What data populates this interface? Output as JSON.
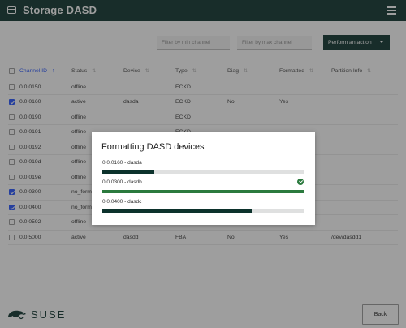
{
  "header": {
    "title": "Storage DASD"
  },
  "filters": {
    "min_placeholder": "Filter by min channel",
    "max_placeholder": "Filter by max channel",
    "action_label": "Perform an action"
  },
  "table": {
    "columns": {
      "channel_id": "Channel ID",
      "status": "Status",
      "device": "Device",
      "type": "Type",
      "diag": "Diag",
      "formatted": "Formatted",
      "partition_info": "Partition Info"
    },
    "rows": [
      {
        "checked": false,
        "channel_id": "0.0.0150",
        "status": "offline",
        "device": "",
        "type": "ECKD",
        "diag": "",
        "formatted": "",
        "partition_info": ""
      },
      {
        "checked": true,
        "channel_id": "0.0.0160",
        "status": "active",
        "device": "dasda",
        "type": "ECKD",
        "diag": "No",
        "formatted": "Yes",
        "partition_info": ""
      },
      {
        "checked": false,
        "channel_id": "0.0.0190",
        "status": "offline",
        "device": "",
        "type": "ECKD",
        "diag": "",
        "formatted": "",
        "partition_info": ""
      },
      {
        "checked": false,
        "channel_id": "0.0.0191",
        "status": "offline",
        "device": "",
        "type": "ECKD",
        "diag": "",
        "formatted": "",
        "partition_info": ""
      },
      {
        "checked": false,
        "channel_id": "0.0.0192",
        "status": "offline",
        "device": "",
        "type": "",
        "diag": "",
        "formatted": "",
        "partition_info": ""
      },
      {
        "checked": false,
        "channel_id": "0.0.019d",
        "status": "offline",
        "device": "",
        "type": "",
        "diag": "",
        "formatted": "",
        "partition_info": ""
      },
      {
        "checked": false,
        "channel_id": "0.0.019e",
        "status": "offline",
        "device": "",
        "type": "",
        "diag": "",
        "formatted": "",
        "partition_info": ""
      },
      {
        "checked": true,
        "channel_id": "0.0.0300",
        "status": "no_formatted",
        "device": "",
        "type": "",
        "diag": "",
        "formatted": "",
        "partition_info": ""
      },
      {
        "checked": true,
        "channel_id": "0.0.0400",
        "status": "no_formatted",
        "device": "",
        "type": "",
        "diag": "",
        "formatted": "",
        "partition_info": ""
      },
      {
        "checked": false,
        "channel_id": "0.0.0592",
        "status": "offline",
        "device": "",
        "type": "",
        "diag": "",
        "formatted": "",
        "partition_info": ""
      },
      {
        "checked": false,
        "channel_id": "0.0.5000",
        "status": "active",
        "device": "dasdd",
        "type": "FBA",
        "diag": "No",
        "formatted": "Yes",
        "partition_info": "/dev/dasdd1"
      }
    ]
  },
  "footer": {
    "logo_text": "SUSE",
    "back_label": "Back"
  },
  "dialog": {
    "title": "Formatting DASD devices",
    "items": [
      {
        "label": "0.0.0160 - dasda",
        "progress": 0.26,
        "done": false
      },
      {
        "label": "0.0.0300 - dasdb",
        "progress": 1.0,
        "done": true
      },
      {
        "label": "0.0.0400 - dasdc",
        "progress": 0.74,
        "done": false
      }
    ]
  },
  "colors": {
    "brand": "#0c322c",
    "accent": "#2453ff",
    "success": "#2b7a3e"
  }
}
